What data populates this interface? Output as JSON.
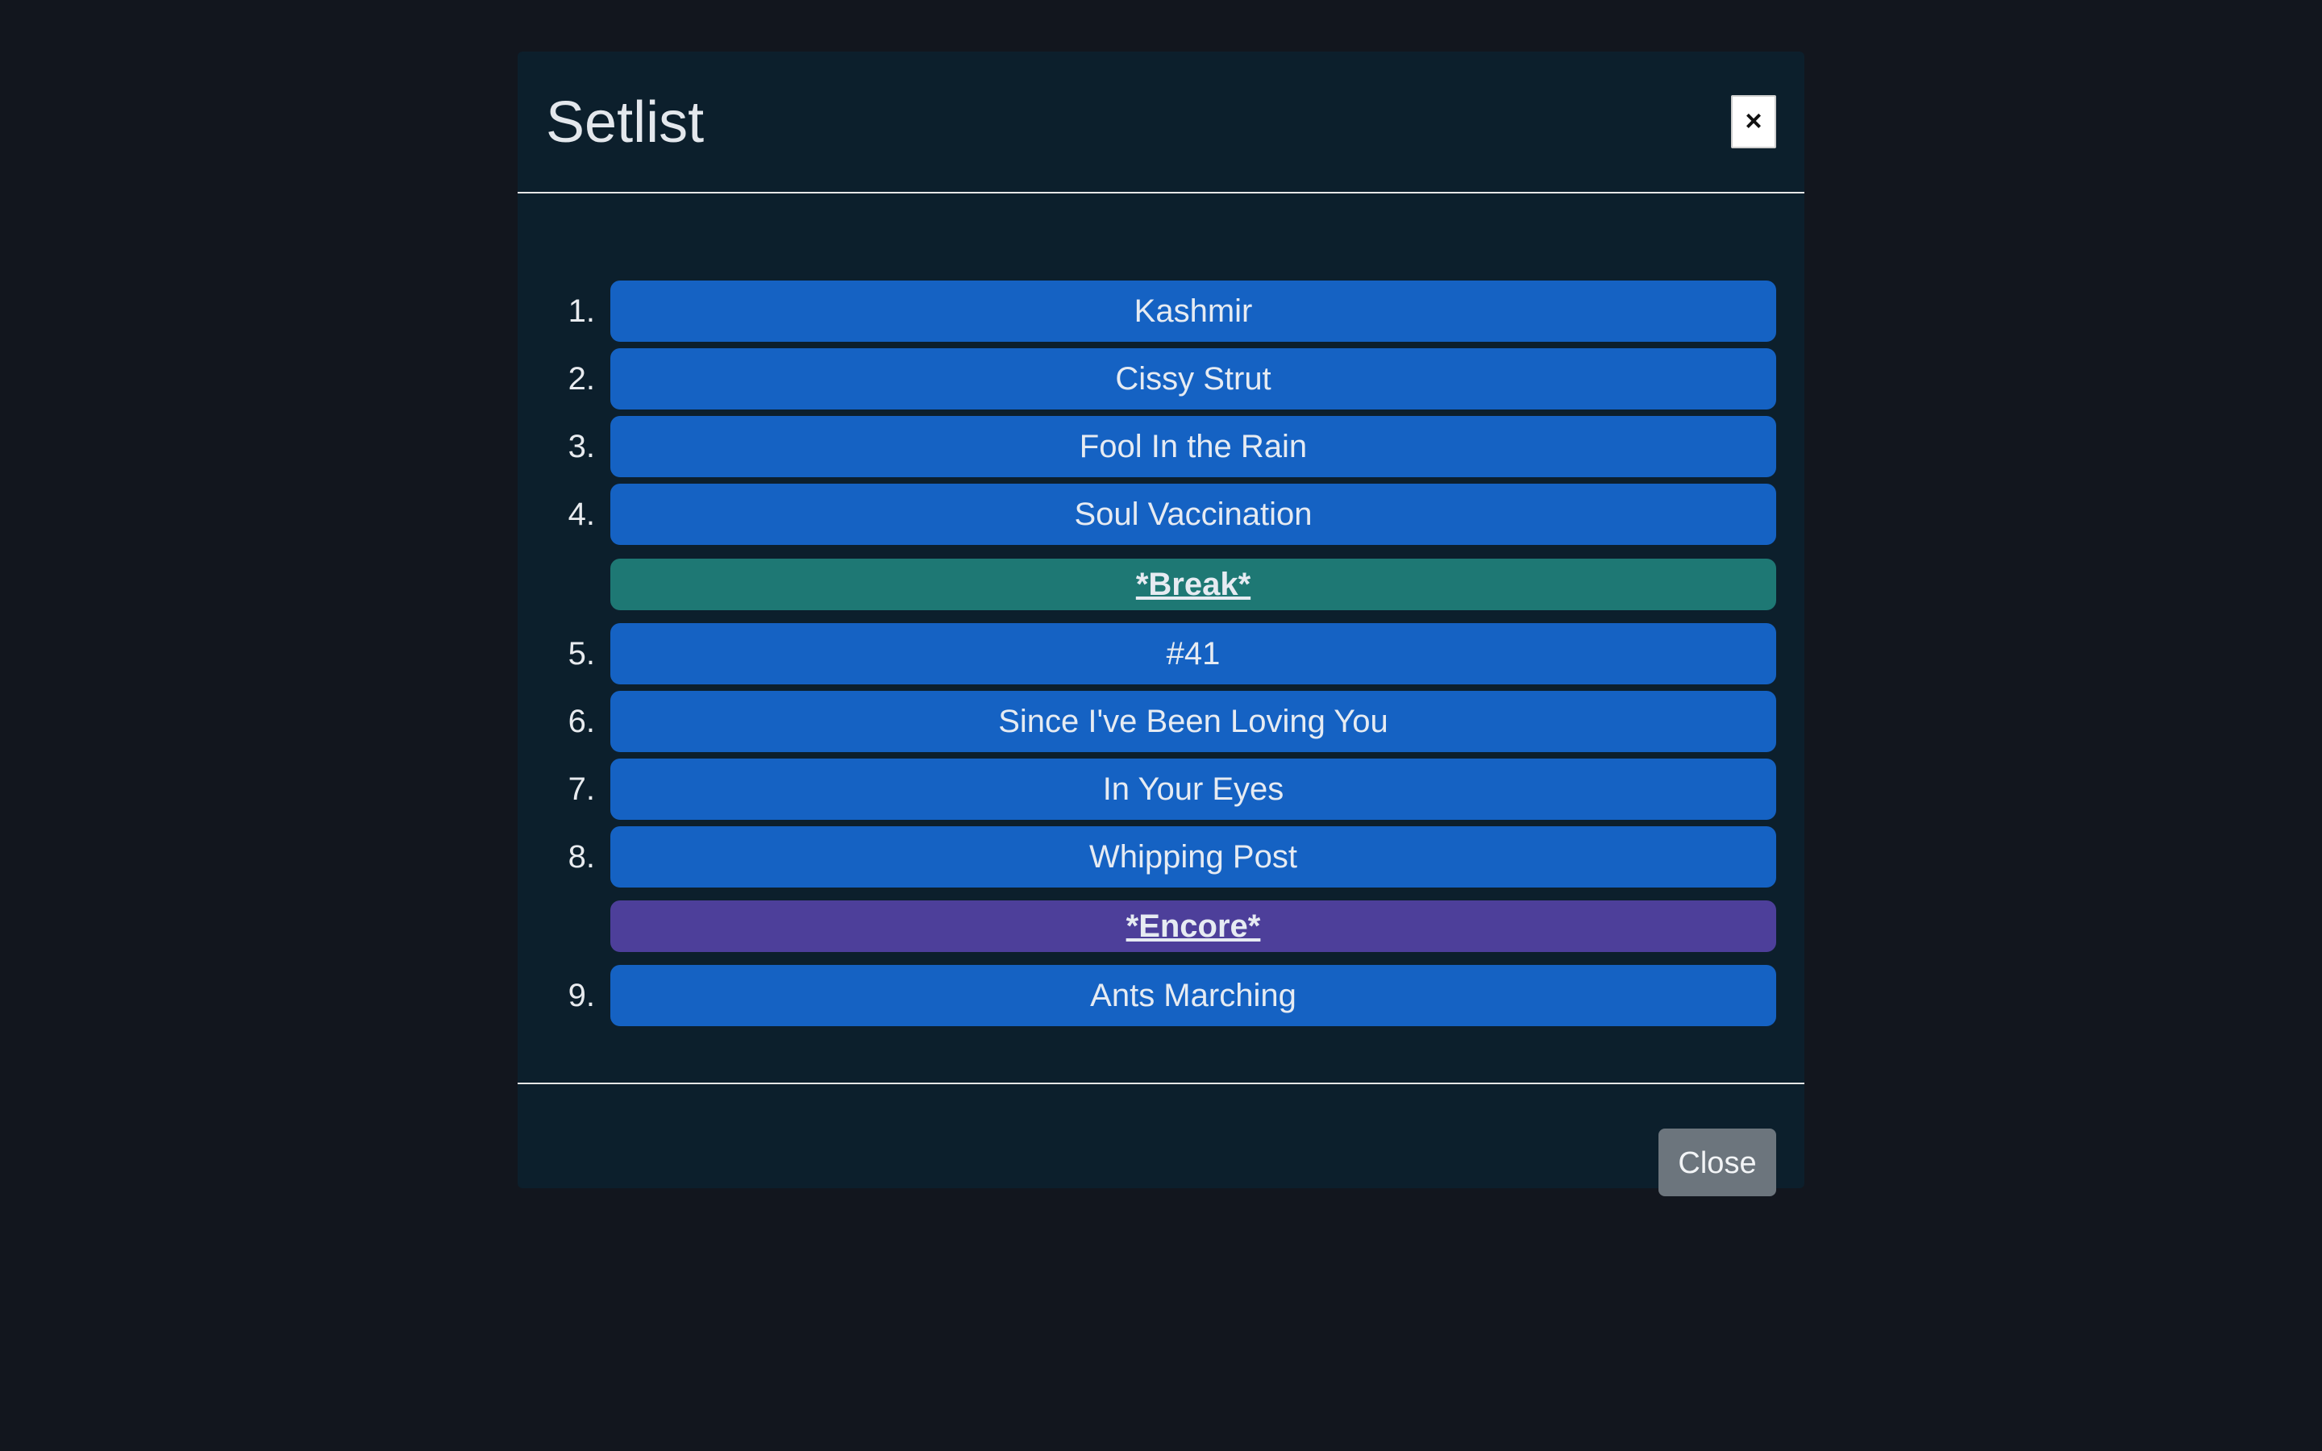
{
  "modal": {
    "title": "Setlist",
    "close_icon": "×",
    "close_label": "Close"
  },
  "setlist": [
    {
      "number": "1.",
      "title": "Kashmir",
      "kind": "song"
    },
    {
      "number": "2.",
      "title": "Cissy Strut",
      "kind": "song"
    },
    {
      "number": "3.",
      "title": "Fool In the Rain",
      "kind": "song"
    },
    {
      "number": "4.",
      "title": "Soul Vaccination",
      "kind": "song"
    },
    {
      "number": "",
      "title": "*Break*",
      "kind": "break"
    },
    {
      "number": "5.",
      "title": "#41",
      "kind": "song"
    },
    {
      "number": "6.",
      "title": "Since I've Been Loving You",
      "kind": "song"
    },
    {
      "number": "7.",
      "title": "In Your Eyes",
      "kind": "song"
    },
    {
      "number": "8.",
      "title": "Whipping Post",
      "kind": "song"
    },
    {
      "number": "",
      "title": "*Encore*",
      "kind": "encore"
    },
    {
      "number": "9.",
      "title": "Ants Marching",
      "kind": "song"
    }
  ],
  "colors": {
    "page_background": "#12161e",
    "modal_background": "#0c1f2c",
    "song_button": "#1562c3",
    "break_button": "#1e7874",
    "encore_button": "#4d3f9a",
    "close_button": "#6c757d"
  }
}
